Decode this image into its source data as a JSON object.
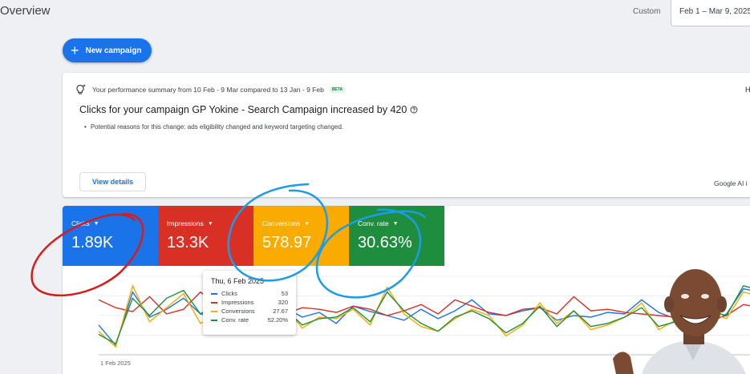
{
  "header": {
    "page_title": "Overview",
    "date_type": "Custom",
    "date_range": "Feb 1 – Mar 9, 2025"
  },
  "new_campaign_label": "New campaign",
  "summary": {
    "intro": "Your performance summary from 10 Feb - 9 Mar compared to 13 Jan - 9 Feb",
    "beta": "BETA",
    "headline": "Clicks for your campaign GP Yokine - Search Campaign increased by 420",
    "reason": "Potential reasons for this change: ads eligibility changed and keyword targeting changed.",
    "view_details": "View details",
    "footer_note": "Google AI i",
    "right_cut": "H"
  },
  "metrics": [
    {
      "label": "Clicks",
      "value": "1.89K",
      "color": "#1a73e8"
    },
    {
      "label": "Impressions",
      "value": "13.3K",
      "color": "#d93025"
    },
    {
      "label": "Conversions",
      "value": "578.97",
      "color": "#f9ab00"
    },
    {
      "label": "Conv. rate",
      "value": "30.63%",
      "color": "#1e8e3e"
    }
  ],
  "tooltip": {
    "date": "Thu, 6 Feb 2025",
    "rows": [
      {
        "name": "Clicks",
        "value": "53",
        "color": "#1a73e8"
      },
      {
        "name": "Impressions",
        "value": "320",
        "color": "#d93025"
      },
      {
        "name": "Conversions",
        "value": "27.67",
        "color": "#f9ab00"
      },
      {
        "name": "Conv. rate",
        "value": "52.20%",
        "color": "#1e8e3e"
      }
    ]
  },
  "chart_data": {
    "type": "line",
    "x_start_label": "1 Feb 2025",
    "series": [
      {
        "name": "Clicks",
        "color": "#1a73e8",
        "values": [
          38,
          12,
          80,
          48,
          58,
          72,
          52,
          66,
          56,
          52,
          50,
          60,
          48,
          54,
          40,
          62,
          55,
          50,
          44,
          58,
          46,
          56,
          70,
          52,
          50,
          56,
          60,
          44,
          50,
          48,
          54,
          52,
          70,
          54,
          46,
          36,
          40,
          52,
          84,
          80
        ]
      },
      {
        "name": "Impressions",
        "color": "#d93025",
        "values": [
          70,
          60,
          55,
          74,
          52,
          58,
          80,
          62,
          68,
          56,
          66,
          52,
          60,
          58,
          54,
          62,
          58,
          50,
          56,
          64,
          52,
          70,
          62,
          54,
          50,
          58,
          60,
          52,
          74,
          56,
          58,
          54,
          52,
          50,
          48,
          40,
          44,
          50,
          64,
          60
        ]
      },
      {
        "name": "Conversions",
        "color": "#f9ab00",
        "values": [
          30,
          10,
          88,
          42,
          60,
          78,
          40,
          50,
          62,
          58,
          54,
          60,
          34,
          48,
          46,
          58,
          38,
          86,
          52,
          36,
          30,
          46,
          58,
          50,
          24,
          38,
          66,
          40,
          56,
          32,
          38,
          48,
          66,
          32,
          44,
          20,
          54,
          46,
          80,
          74
        ]
      },
      {
        "name": "Conv. rate",
        "color": "#1e8e3e",
        "values": [
          26,
          14,
          72,
          50,
          72,
          82,
          52,
          48,
          64,
          52,
          44,
          58,
          38,
          46,
          48,
          60,
          42,
          80,
          56,
          40,
          30,
          48,
          56,
          46,
          28,
          40,
          62,
          36,
          56,
          36,
          40,
          48,
          60,
          36,
          42,
          28,
          56,
          50,
          88,
          82
        ]
      }
    ]
  }
}
